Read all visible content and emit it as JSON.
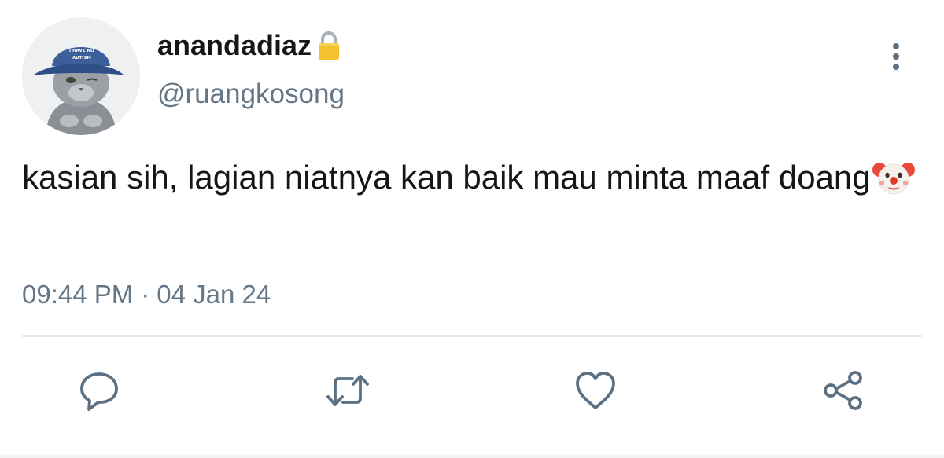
{
  "user": {
    "display_name": "anandadiaz",
    "handle": "@ruangkosong",
    "avatar_icon": "avatar-cat-in-cap",
    "cap_text": [
      "I HAVE NO",
      "AUTISM"
    ],
    "protected_icon": "lock-icon"
  },
  "tweet": {
    "text": "kasian sih, lagian niatnya kan baik mau minta maaf doang",
    "emoji": "clown-face-icon",
    "time": "09:44 PM",
    "separator": "·",
    "date": "04 Jan 24"
  },
  "actions": {
    "reply_icon": "speech-bubble-icon",
    "retweet_icon": "retweet-icon",
    "like_icon": "heart-icon",
    "share_icon": "share-icon",
    "more_icon": "vertical-dots-icon"
  },
  "colors": {
    "text": "#14171a",
    "secondary": "#657786",
    "icon": "#5b7083",
    "divider": "#e1e8ed"
  }
}
